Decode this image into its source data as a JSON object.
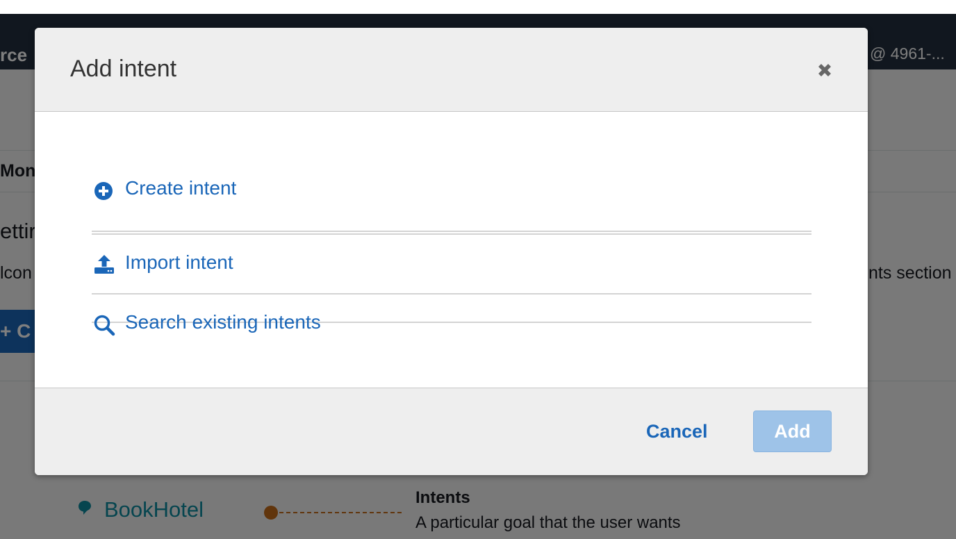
{
  "background": {
    "nav_brand_fragment": "rce",
    "nav_account_fragment": "@ 4961-...",
    "tab_fragment": "Mon",
    "heading_fragment": "ettir",
    "welcome_left_fragment": "lcon",
    "welcome_right_fragment": "nts section",
    "create_button_fragment": "+ C",
    "diagram": {
      "item_label": "BookHotel",
      "term_title": "Intents",
      "term_description": "A particular goal that the user wants"
    }
  },
  "modal": {
    "title": "Add intent",
    "close_icon": "close-icon",
    "options": [
      {
        "label": "Create intent",
        "icon": "plus-circle-icon"
      },
      {
        "label": "Import intent",
        "icon": "upload-icon"
      },
      {
        "label": "Search existing intents",
        "icon": "search-icon"
      }
    ],
    "footer": {
      "cancel_label": "Cancel",
      "add_label": "Add"
    }
  },
  "colors": {
    "link_blue": "#1a66b8",
    "nav_dark": "#232f3e",
    "add_disabled": "#9ec3e8",
    "diagram_teal": "#0d8b9e",
    "diagram_orange": "#c26b18"
  }
}
